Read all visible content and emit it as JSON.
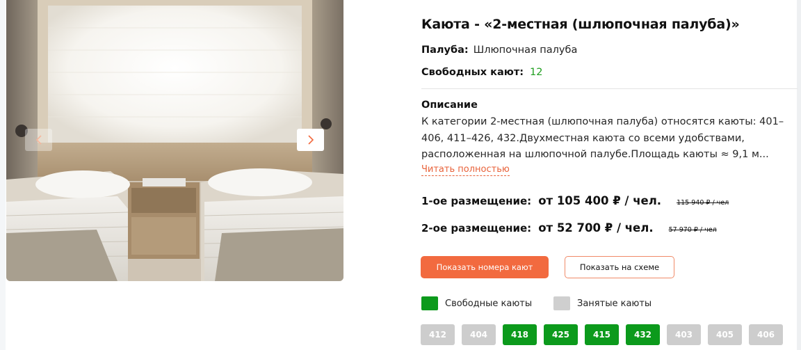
{
  "gallery": {
    "prev_icon": "chevron-left-icon",
    "next_icon": "chevron-right-icon"
  },
  "cabin": {
    "title": "Каюта - «2-местная (шлюпочная палуба)»",
    "deck_label": "Палуба:",
    "deck_value": "Шлюпочная палуба",
    "free_label": "Свободных кают:",
    "free_value": "12"
  },
  "description": {
    "heading": "Описание",
    "text": "К категории 2-местная (шлюпочная палуба) относятся каюты: 401–406, 411–426, 432.Двухместная каюта со всеми удобствами, расположенная на шлюпочной палубе.Площадь каюты ≈ 9,1 м...",
    "read_more": "Читать полностью"
  },
  "prices": [
    {
      "label": "1-ое размещение:",
      "value": "от 105 400 ₽ / чел.",
      "old": "115 940 ₽ / чел"
    },
    {
      "label": "2-ое размещение:",
      "value": "от 52 700 ₽ / чел.",
      "old": "57 970 ₽ / чел"
    }
  ],
  "buttons": {
    "show_numbers": "Показать номера кают",
    "show_scheme": "Показать на схеме"
  },
  "legend": {
    "free": "Свободные каюты",
    "busy": "Занятые каюты",
    "free_color": "#0c9a1c",
    "busy_color": "#cfcfcf"
  },
  "cabins": [
    {
      "number": "412",
      "status": "busy"
    },
    {
      "number": "404",
      "status": "busy"
    },
    {
      "number": "418",
      "status": "free"
    },
    {
      "number": "425",
      "status": "free"
    },
    {
      "number": "415",
      "status": "free"
    },
    {
      "number": "432",
      "status": "free"
    },
    {
      "number": "403",
      "status": "busy"
    },
    {
      "number": "405",
      "status": "busy"
    },
    {
      "number": "406",
      "status": "busy"
    }
  ],
  "colors": {
    "accent": "#f26a3f",
    "free_green": "#1e9e1e"
  }
}
